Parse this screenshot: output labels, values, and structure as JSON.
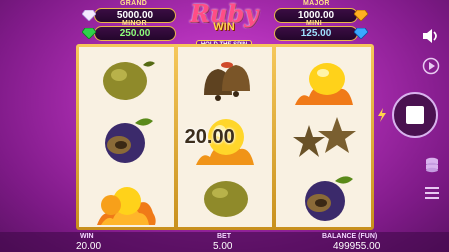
{
  "jackpots": {
    "grand": {
      "label": "GRAND",
      "value": "5000.00"
    },
    "major": {
      "label": "MAJOR",
      "value": "1000.00"
    },
    "minor": {
      "label": "MINOR",
      "value": "250.00"
    },
    "mini": {
      "label": "MINI",
      "value": "125.00"
    }
  },
  "logo": {
    "title": "Ruby",
    "subtitle": "WIN",
    "tagline": "HOLD THE SPIN"
  },
  "reels": {
    "symbols": [
      [
        "lemon",
        "plum",
        "fire-orange"
      ],
      [
        "bells",
        "coin-value",
        "lemon"
      ],
      [
        "fire-lemon",
        "stars",
        "plum"
      ]
    ],
    "coin_value": "20.00"
  },
  "controls": {
    "sound_icon": "speaker-icon",
    "autoplay_icon": "play-circle-icon",
    "turbo_icon": "lightning-icon",
    "spin_icon": "stop-square-icon",
    "bet_icon": "coin-stack-icon",
    "menu_icon": "hamburger-icon"
  },
  "footer": {
    "win_label": "WIN",
    "win_value": "20.00",
    "bet_label": "BET",
    "bet_value": "5.00",
    "balance_label": "BALANCE (FUN)",
    "balance_value": "499955.00"
  },
  "colors": {
    "accent": "#e9b74a",
    "background": "#b02fb6",
    "reel_bg": "#f9f1e2"
  }
}
